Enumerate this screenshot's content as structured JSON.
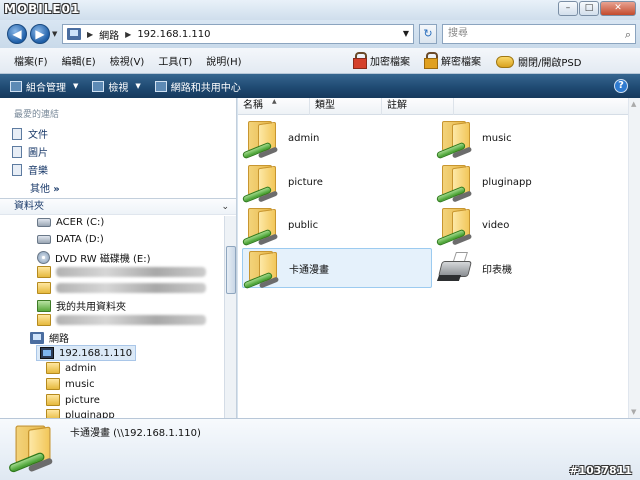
{
  "titlebar": {
    "logo": "MOBILE01",
    "buttons": [
      "–",
      "□",
      "✕"
    ]
  },
  "address": {
    "path": [
      "網路",
      "192.168.1.110"
    ],
    "search_placeholder": "搜尋"
  },
  "menu": {
    "items": [
      "檔案(F)",
      "編輯(E)",
      "檢視(V)",
      "工具(T)",
      "說明(H)"
    ],
    "encrypt": "加密檔案",
    "decrypt": "解密檔案",
    "psd": "關閉/開啟PSD"
  },
  "commandbar": {
    "organize": "組合管理",
    "views": "檢視",
    "network_center": "網路和共用中心"
  },
  "navpane": {
    "favorites_title": "最愛的連結",
    "favorites": [
      "文件",
      "圖片",
      "音樂"
    ],
    "more": "其他",
    "folders_title": "資料夾",
    "tree": {
      "acer": "ACER (C:)",
      "data": "DATA (D:)",
      "dvd": "DVD RW 磁碟機 (E:)",
      "shared": "我的共用資料夾",
      "network": "網路",
      "host": "192.168.1.110",
      "children": [
        "admin",
        "music",
        "picture",
        "pluginapp"
      ]
    }
  },
  "content": {
    "columns": [
      "名稱",
      "類型",
      "註解"
    ],
    "left_items": [
      "admin",
      "picture",
      "public",
      "卡通漫畫"
    ],
    "right_items": [
      "music",
      "pluginapp",
      "video",
      "印表機"
    ]
  },
  "details": {
    "text": "卡通漫畫 (\\\\192.168.1.110)"
  },
  "watermark": "#1037811"
}
